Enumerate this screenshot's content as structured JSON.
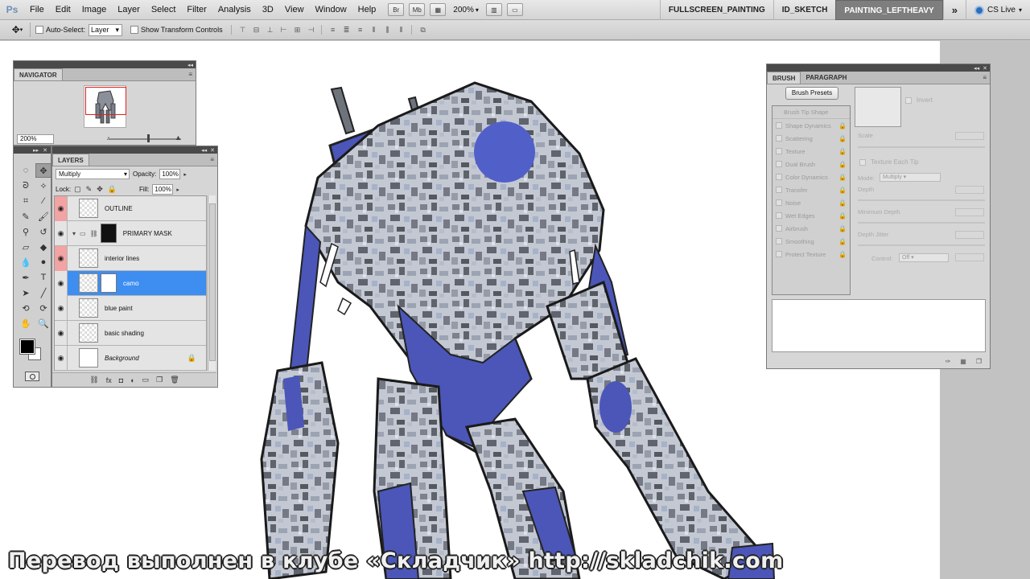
{
  "app": {
    "logo": "Ps"
  },
  "menu": [
    "File",
    "Edit",
    "Image",
    "Layer",
    "Select",
    "Filter",
    "Analysis",
    "3D",
    "View",
    "Window",
    "Help"
  ],
  "menubar_buttons": {
    "br": "Br",
    "mb": "Mb",
    "zoom": "200%"
  },
  "workspaces": [
    "FULLSCREEN_PAINTING",
    "ID_SKETCH",
    "PAINTING_LEFTHEAVY"
  ],
  "more_workspaces": "»",
  "cs_live": "CS Live",
  "options": {
    "auto_select_label": "Auto-Select:",
    "auto_select_value": "Layer",
    "transform_label": "Show Transform Controls"
  },
  "navigator": {
    "tab": "NAVIGATOR",
    "zoom": "200%"
  },
  "layers_panel": {
    "tab": "LAYERS",
    "blend_mode": "Multiply",
    "opacity_label": "Opacity:",
    "opacity": "100%",
    "lock_label": "Lock:",
    "fill_label": "Fill:",
    "fill": "100%",
    "layers": [
      {
        "name": "OUTLINE"
      },
      {
        "name": "PRIMARY MASK"
      },
      {
        "name": "interior lines"
      },
      {
        "name": "camo"
      },
      {
        "name": "blue paint"
      },
      {
        "name": "basic shading"
      },
      {
        "name": "Background"
      }
    ]
  },
  "brush_panel": {
    "tabs": [
      "BRUSH",
      "PARAGRAPH"
    ],
    "presets_button": "Brush Presets",
    "tip_shape": "Brush Tip Shape",
    "options": [
      "Shape Dynamics",
      "Scattering",
      "Texture",
      "Dual Brush",
      "Color Dynamics",
      "Transfer",
      "Noise",
      "Wet Edges",
      "Airbrush",
      "Smoothing",
      "Protect Texture"
    ],
    "invert": "Invert",
    "scale": "Scale",
    "texture_each_tip": "Texture Each Tip",
    "mode_label": "Mode:",
    "mode_value": "Multiply",
    "depth": "Depth",
    "min_depth": "Minimum Depth",
    "depth_jitter": "Depth Jitter",
    "control_label": "Control:",
    "control_value": "Off"
  },
  "subtitle": "Перевод выполнен в клубе «Складчик» http://skladchik.com",
  "colors": {
    "accent_selected": "#3d8ef0",
    "robot_blue": "#4b56b8",
    "camo_gray": "#9a9ea8"
  }
}
